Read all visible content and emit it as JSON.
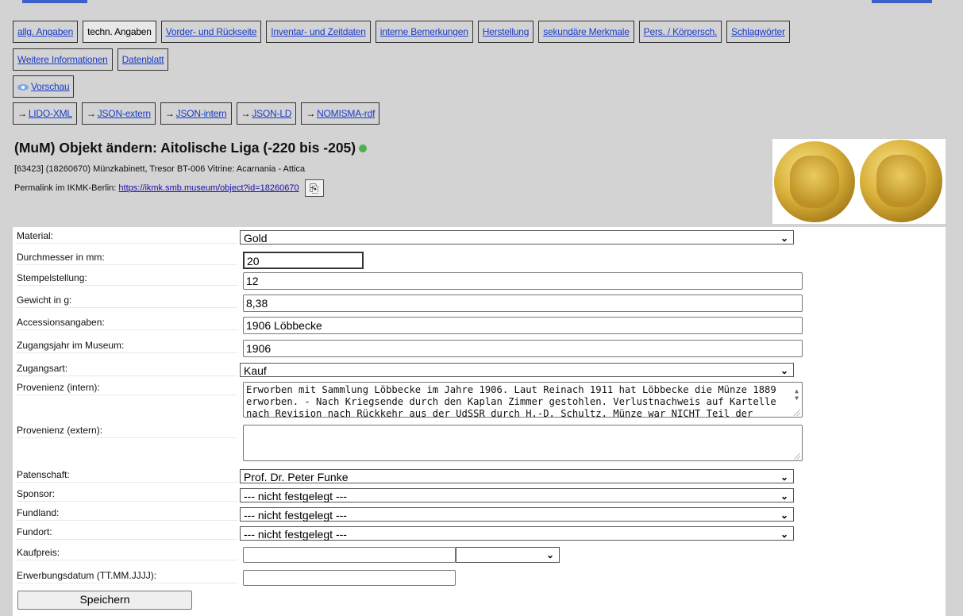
{
  "tabs_row1": [
    "allg. Angaben",
    "techn. Angaben",
    "Vorder- und Rückseite",
    "Inventar- und Zeitdaten",
    "interne Bemerkungen",
    "Herstellung",
    "sekundäre Merkmale",
    "Pers. / Körpersch.",
    "Schlagwörter"
  ],
  "tabs_row2": [
    "Weitere Informationen",
    "Datenblatt"
  ],
  "preview": "Vorschau",
  "exports": [
    "LIDO-XML",
    "JSON-extern",
    "JSON-intern",
    "JSON-LD",
    "NOMISMA-rdf"
  ],
  "title": "(MuM) Objekt ändern: Aitolische Liga (-220 bis -205)",
  "location": "[63423] (18260670) Münzkabinett, Tresor BT-006 Vitrine: Acarnania - Attica",
  "permalink": {
    "label": "Permalink im IKMK-Berlin:",
    "url": "https://ikmk.smb.museum/object?id=18260670"
  },
  "form": {
    "material": {
      "label": "Material:",
      "value": "Gold"
    },
    "durchmesser": {
      "label": "Durchmesser in mm:",
      "value": "20"
    },
    "stempelstellung": {
      "label": "Stempelstellung:",
      "value": "12"
    },
    "gewicht": {
      "label": "Gewicht in g:",
      "value": "8,38"
    },
    "accession": {
      "label": "Accessionsangaben:",
      "value": "1906 Löbbecke"
    },
    "zugangsjahr": {
      "label": "Zugangsjahr im Museum:",
      "value": "1906"
    },
    "zugangsart": {
      "label": "Zugangsart:",
      "value": "Kauf"
    },
    "provenienz_intern": {
      "label": "Provenienz (intern):",
      "value": "Erworben mit Sammlung Löbbecke im Jahre 1906. Laut Reinach 1911 hat Löbbecke die Münze 1889 erworben. - Nach Kriegsende durch den Kaplan Zimmer gestohlen. Verlustnachweis auf Kartelle nach Revision nach Rückkehr aus der UdSSR durch H.-D. Schultz. Münze war NICHT Teil der"
    },
    "provenienz_extern": {
      "label": "Provenienz (extern):",
      "value": ""
    },
    "patenschaft": {
      "label": "Patenschaft:",
      "value": "Prof. Dr. Peter Funke"
    },
    "sponsor": {
      "label": "Sponsor:",
      "value": "--- nicht festgelegt ---"
    },
    "fundland": {
      "label": "Fundland:",
      "value": "--- nicht festgelegt ---"
    },
    "fundort": {
      "label": "Fundort:",
      "value": "--- nicht festgelegt ---"
    },
    "kaufpreis": {
      "label": "Kaufpreis:",
      "value": "",
      "currency": ""
    },
    "erwerbungsdatum": {
      "label": "Erwerbungsdatum (TT.MM.JJJJ):",
      "value": ""
    },
    "save": "Speichern"
  }
}
